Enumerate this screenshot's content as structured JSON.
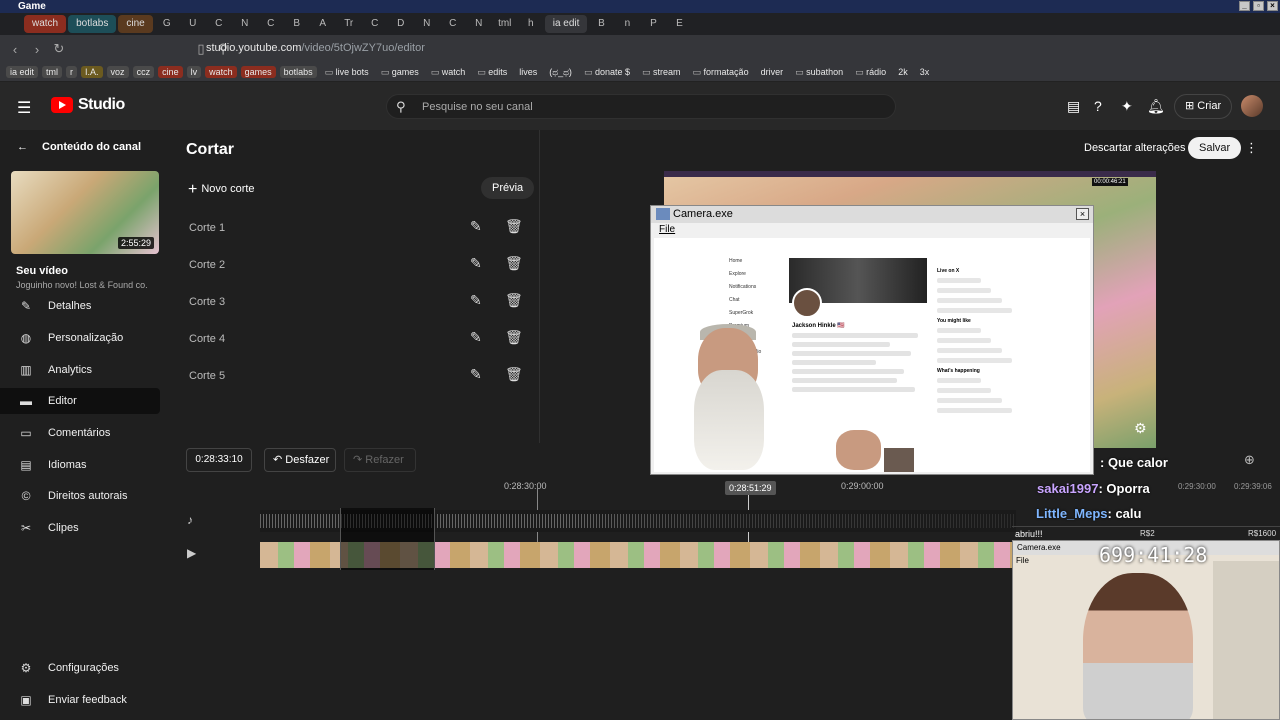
{
  "window": {
    "title": "Game"
  },
  "tabs": [
    {
      "label": "watch",
      "style": "red"
    },
    {
      "label": "botlabs",
      "style": "teal"
    },
    {
      "label": "cine",
      "style": "brown"
    },
    {
      "label": "G"
    },
    {
      "label": "U"
    },
    {
      "label": "C"
    },
    {
      "label": "N"
    },
    {
      "label": "C"
    },
    {
      "label": "B"
    },
    {
      "label": "A"
    },
    {
      "label": "Tr"
    },
    {
      "label": "C"
    },
    {
      "label": "D"
    },
    {
      "label": "N"
    },
    {
      "label": "C"
    },
    {
      "label": "N"
    },
    {
      "label": "tml"
    },
    {
      "label": "h"
    },
    {
      "label": "ia edit",
      "style": "active"
    },
    {
      "label": "B"
    },
    {
      "label": "n"
    },
    {
      "label": "P"
    },
    {
      "label": "E"
    }
  ],
  "address": {
    "host": "studio.youtube.com",
    "path": "/video/5tOjwZY7uo/editor"
  },
  "bookmarks": [
    {
      "label": "ia edit",
      "style": "chip"
    },
    {
      "label": "tml",
      "style": "chip"
    },
    {
      "label": "r",
      "style": "chip"
    },
    {
      "label": "I.A.",
      "style": "chip yellow"
    },
    {
      "label": "voz",
      "style": "chip"
    },
    {
      "label": "ccz",
      "style": "chip"
    },
    {
      "label": "cine",
      "style": "chip red"
    },
    {
      "label": "lv",
      "style": "chip"
    },
    {
      "label": "watch",
      "style": "chip red"
    },
    {
      "label": "games",
      "style": "chip red"
    },
    {
      "label": "botlabs",
      "style": "chip"
    },
    {
      "label": "live bots",
      "style": "folder"
    },
    {
      "label": "games",
      "style": "folder"
    },
    {
      "label": "watch",
      "style": "folder"
    },
    {
      "label": "edits",
      "style": "folder"
    },
    {
      "label": "lives",
      "style": ""
    },
    {
      "label": "(ಥ_ಥ)",
      "style": ""
    },
    {
      "label": "donate $",
      "style": "folder"
    },
    {
      "label": "stream",
      "style": "folder"
    },
    {
      "label": "formatação",
      "style": "folder"
    },
    {
      "label": "driver",
      "style": ""
    },
    {
      "label": "subathon",
      "style": "folder"
    },
    {
      "label": "rádio",
      "style": "folder"
    },
    {
      "label": "2k",
      "style": ""
    },
    {
      "label": "3x",
      "style": ""
    }
  ],
  "header": {
    "logo_text": "Studio",
    "search_placeholder": "Pesquise no seu canal",
    "create_label": "Criar"
  },
  "sidebar": {
    "back_label": "Conteúdo do canal",
    "thumb_duration": "2:55:29",
    "your_video": "Seu vídeo",
    "video_title": "Joguinho novo! Lost & Found co.",
    "items": [
      {
        "label": "Detalhes",
        "icon": "pencil-icon",
        "glyph": "✎"
      },
      {
        "label": "Personalização",
        "icon": "wand-icon",
        "glyph": "◍"
      },
      {
        "label": "Analytics",
        "icon": "analytics-icon",
        "glyph": "▥"
      },
      {
        "label": "Editor",
        "icon": "editor-icon",
        "glyph": "▬"
      },
      {
        "label": "Comentários",
        "icon": "comments-icon",
        "glyph": "▭"
      },
      {
        "label": "Idiomas",
        "icon": "subtitles-icon",
        "glyph": "▤"
      },
      {
        "label": "Direitos autorais",
        "icon": "copyright-icon",
        "glyph": "©"
      },
      {
        "label": "Clipes",
        "icon": "scissors-icon",
        "glyph": "✂"
      }
    ],
    "bottom": [
      {
        "label": "Configurações",
        "icon": "gear-icon",
        "glyph": "⚙"
      },
      {
        "label": "Enviar feedback",
        "icon": "feedback-icon",
        "glyph": "▣"
      }
    ]
  },
  "editor": {
    "title": "Cortar",
    "discard_label": "Descartar alterações",
    "save_label": "Salvar",
    "new_cut_label": "Novo corte",
    "preview_label": "Prévia",
    "cuts": [
      "Corte 1",
      "Corte 2",
      "Corte 3",
      "Corte 4",
      "Corte 5"
    ],
    "timecode": "0:28:33:10",
    "undo_label": "Desfazer",
    "redo_label": "Refazer",
    "ruler": {
      "left": "0:28:30:00",
      "playhead": "0:28:51:29",
      "right": "0:29:00:00"
    }
  },
  "camera_window": {
    "title": "Camera.exe",
    "menu": "File",
    "profile_name": "Jackson Hinkle 🇺🇸",
    "nav": [
      "Home",
      "Explore",
      "Notifications",
      "Chat",
      "SuperGrok",
      "Premium",
      "Bookmarks",
      "Creator Studio",
      "Articles",
      "Profile",
      "More"
    ],
    "side_headings": [
      "Live on X",
      "You might like",
      "What's happening"
    ]
  },
  "overlay": {
    "chat": [
      {
        "user": "",
        "text": ": Que calor"
      },
      {
        "user": "sakai1997",
        "text": ": Oporra"
      },
      {
        "user": "Little_Meps",
        "text": ": calu"
      }
    ],
    "times": [
      "0:29:30:00",
      "0:29:39:06"
    ],
    "cam2_title": "Camera.exe",
    "cam2_menu": "File",
    "cam2_clock": "699:41:28",
    "alert": "abriu!!!",
    "money_left": "R$2",
    "money_right": "R$1600",
    "live_timecode": "00:00:46:21"
  }
}
